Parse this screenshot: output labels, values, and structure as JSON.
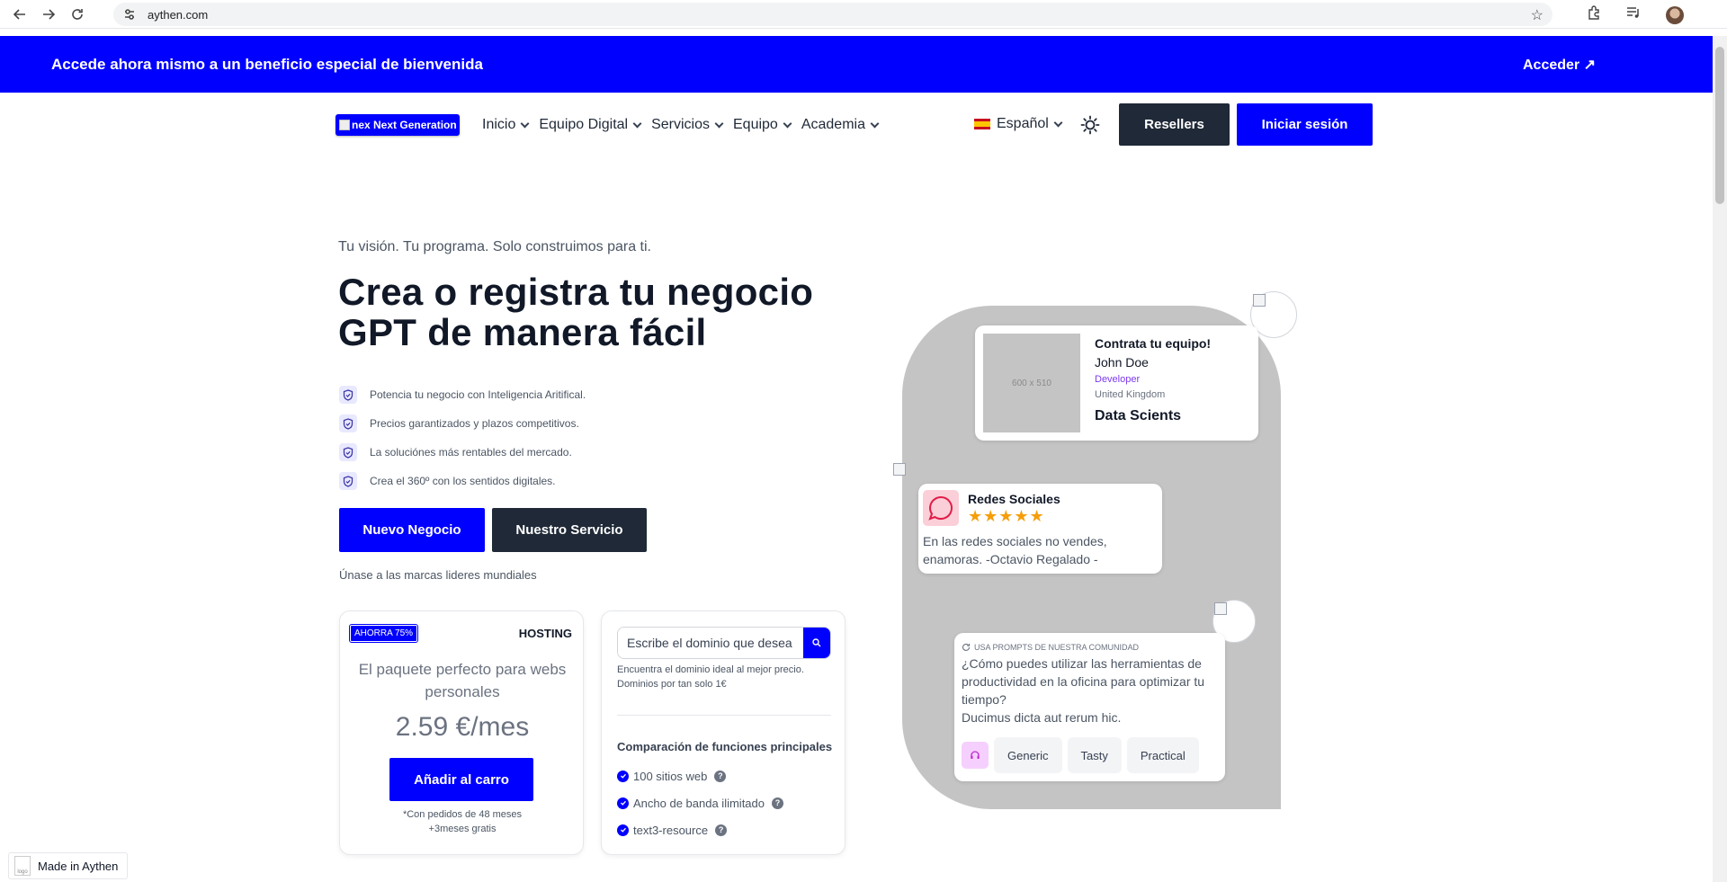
{
  "browser": {
    "url": "aythen.com"
  },
  "promo": {
    "text": "Accede ahora mismo a un beneficio especial de bienvenida",
    "link": "Acceder ↗"
  },
  "header": {
    "logo_text": "nex Next Generation",
    "nav": [
      {
        "label": "Inicio"
      },
      {
        "label": "Equipo Digital"
      },
      {
        "label": "Servicios"
      },
      {
        "label": "Equipo"
      },
      {
        "label": "Academia"
      }
    ],
    "language": "Español",
    "resellers": "Resellers",
    "login": "Iniciar sesión"
  },
  "hero": {
    "tagline": "Tu visión. Tu programa. Solo construimos para ti.",
    "title": "Crea o registra tu negocio GPT de manera fácil",
    "features": [
      "Potencia tu negocio con Inteligencia Aritifical.",
      "Precios garantizados y plazos competitivos.",
      "La soluciónes más rentables del mercado.",
      "Crea el 360º con los sentidos digitales."
    ],
    "cta_primary": "Nuevo Negocio",
    "cta_secondary": "Nuestro Servicio",
    "join_text": "Únase a las marcas lideres mundiales"
  },
  "hosting": {
    "badge": "AHORRA 75%",
    "label": "HOSTING",
    "description": "El paquete perfecto para webs personales",
    "price": "2.59 €/mes",
    "button": "Añadir al carro",
    "note_line1": "*Con pedidos de 48 meses",
    "note_line2": "+3meses gratis"
  },
  "domain": {
    "input_value": "Escribe el dominio que desea",
    "hint_line1": "Encuentra el dominio ideal al mejor precio.",
    "hint_line2": "Dominios por tan solo 1€",
    "compare_title": "Comparación de funciones principales",
    "features": [
      "100 sitios web",
      "Ancho de banda ilimitado",
      "text3-resource"
    ]
  },
  "team_card": {
    "image_placeholder": "600 x 510",
    "title": "Contrata tu equipo!",
    "name": "John Doe",
    "role": "Developer",
    "country": "United Kingdom",
    "field": "Data Scients"
  },
  "social_card": {
    "title": "Redes Sociales",
    "stars": "★★★★★",
    "rating": 5,
    "quote": "En las redes sociales no vendes, enamoras. -Octavio Regalado -"
  },
  "prompt_card": {
    "label": "USA PROMPTS DE NUESTRA COMUNIDAD",
    "question": "¿Cómo puedes utilizar las herramientas de productividad en la oficina para optimizar tu tiempo?",
    "answer": "Ducimus dicta aut rerum hic.",
    "tags": [
      "Generic",
      "Tasty",
      "Practical"
    ]
  },
  "made_in": {
    "logo_alt": "logo",
    "text": "Made in Aythen"
  }
}
